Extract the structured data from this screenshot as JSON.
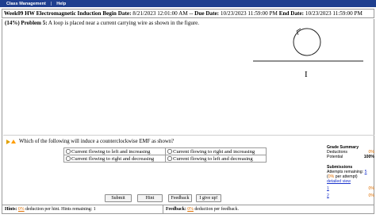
{
  "menu": {
    "items": [
      "Class Management",
      "Help"
    ],
    "separator": "|"
  },
  "header": {
    "title": "Week09 HW Electromagnetic Induction",
    "begin_label": "Begin Date:",
    "begin_date": "8/21/2023 12:01:00 AM",
    "dash": "--",
    "due_label": "Due Date:",
    "due_date": "10/23/2023 11:59:00 PM",
    "end_label": "End Date:",
    "end_date": "10/23/2023 11:59:00 PM"
  },
  "problem": {
    "weight": "(14%)",
    "label": "Problem 5:",
    "text": "A loop is placed near a current carrying wire as shown in the figure.",
    "figure_label": "I"
  },
  "question": {
    "text": "Which of the following will induce a counterclockwise EMF as shown?",
    "options": [
      [
        "Current flowing to left and increasing",
        "Current flowing to right and increasing"
      ],
      [
        "Current flowing to right and decreasing",
        "Current flowing to left and decreasing"
      ]
    ]
  },
  "buttons": {
    "submit": "Submit",
    "hint": "Hint",
    "feedback": "Feedback",
    "give_up": "I give up!"
  },
  "grade": {
    "title": "Grade Summary",
    "deductions_label": "Deductions",
    "deductions_value": "0%",
    "potential_label": "Potential",
    "potential_value": "100%",
    "submissions_title": "Submissions",
    "attempts_text": "Attempts remaining:",
    "attempts_value": "5",
    "per_attempt_pct": "0%",
    "per_attempt_text": "per attempt)",
    "detailed_view": "detailed view",
    "rows": [
      {
        "n": "1",
        "v": "0%"
      },
      {
        "n": "2",
        "v": "0%"
      }
    ]
  },
  "footer": {
    "hints_label": "Hints:",
    "hints_pct": "0%",
    "hints_text": "deduction per hint. Hints remaining:",
    "hints_remaining": "1",
    "feedback_label": "Feedback:",
    "feedback_pct": "0%",
    "feedback_text": "deduction per feedback."
  }
}
